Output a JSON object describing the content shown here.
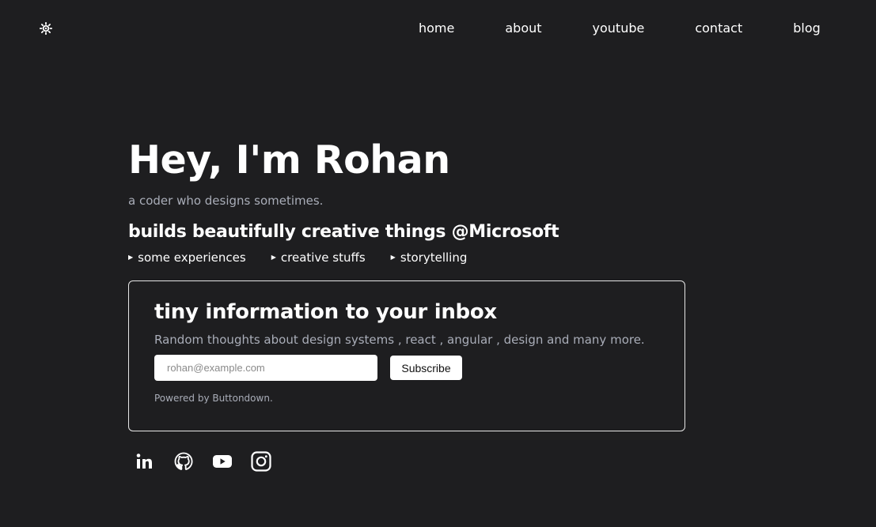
{
  "header": {
    "theme_icon": "sun-icon",
    "nav": [
      {
        "label": "home"
      },
      {
        "label": "about"
      },
      {
        "label": "youtube"
      },
      {
        "label": "contact"
      },
      {
        "label": "blog"
      }
    ]
  },
  "hero": {
    "title": "Hey, I'm Rohan",
    "tagline": "a coder who designs sometimes.",
    "builds": "builds beautifully creative things @Microsoft",
    "links": [
      {
        "label": "some experiences"
      },
      {
        "label": "creative stuffs"
      },
      {
        "label": "storytelling"
      }
    ]
  },
  "newsletter": {
    "title": "tiny information to your inbox",
    "description": "Random thoughts about design systems , react , angular , design and many more.",
    "email_placeholder": "rohan@example.com",
    "subscribe_label": "Subscribe",
    "powered_by": "Powered by Buttondown."
  },
  "socials": [
    {
      "icon": "linkedin-icon"
    },
    {
      "icon": "github-icon"
    },
    {
      "icon": "youtube-icon"
    },
    {
      "icon": "instagram-icon"
    }
  ],
  "colors": {
    "background": "#1e1e20",
    "text": "#ffffff",
    "muted": "#a9adb8"
  }
}
